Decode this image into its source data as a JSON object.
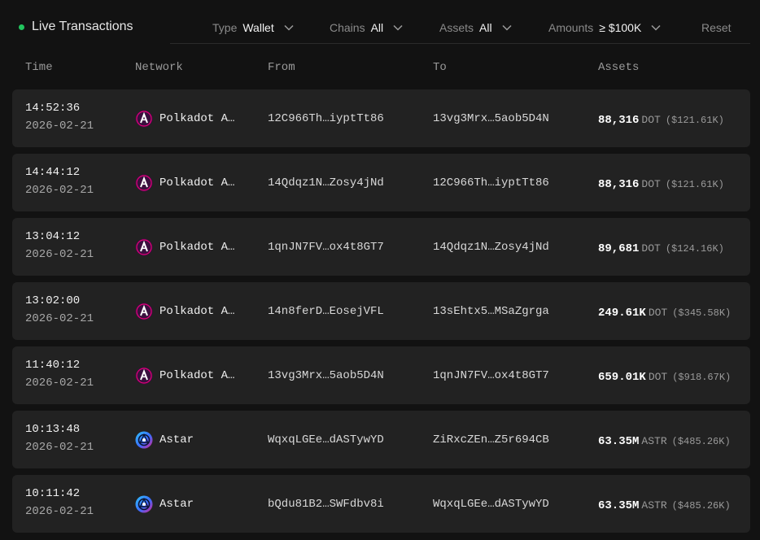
{
  "header": {
    "title": "Live Transactions",
    "live_color": "#22c55e",
    "filters": [
      {
        "label": "Type",
        "value": "Wallet"
      },
      {
        "label": "Chains",
        "value": "All"
      },
      {
        "label": "Assets",
        "value": "All"
      },
      {
        "label": "Amounts",
        "value": "≥ $100K"
      }
    ],
    "reset_label": "Reset"
  },
  "table": {
    "columns": [
      "Time",
      "Network",
      "From",
      "To",
      "Assets"
    ],
    "rows": [
      {
        "time": "14:52:36",
        "date": "2026-02-21",
        "network": "Polkadot A…",
        "network_icon": "polkadot-asset-hub-icon",
        "from": "12C966Th…iyptTt86",
        "to": "13vg3Mrx…5aob5D4N",
        "amount": "88,316",
        "symbol": "DOT",
        "usd": "($121.61K)"
      },
      {
        "time": "14:44:12",
        "date": "2026-02-21",
        "network": "Polkadot A…",
        "network_icon": "polkadot-asset-hub-icon",
        "from": "14Qdqz1N…Zosy4jNd",
        "to": "12C966Th…iyptTt86",
        "amount": "88,316",
        "symbol": "DOT",
        "usd": "($121.61K)"
      },
      {
        "time": "13:04:12",
        "date": "2026-02-21",
        "network": "Polkadot A…",
        "network_icon": "polkadot-asset-hub-icon",
        "from": "1qnJN7FV…ox4t8GT7",
        "to": "14Qdqz1N…Zosy4jNd",
        "amount": "89,681",
        "symbol": "DOT",
        "usd": "($124.16K)"
      },
      {
        "time": "13:02:00",
        "date": "2026-02-21",
        "network": "Polkadot A…",
        "network_icon": "polkadot-asset-hub-icon",
        "from": "14n8ferD…EosejVFL",
        "to": "13sEhtx5…MSaZgrga",
        "amount": "249.61K",
        "symbol": "DOT",
        "usd": "($345.58K)"
      },
      {
        "time": "11:40:12",
        "date": "2026-02-21",
        "network": "Polkadot A…",
        "network_icon": "polkadot-asset-hub-icon",
        "from": "13vg3Mrx…5aob5D4N",
        "to": "1qnJN7FV…ox4t8GT7",
        "amount": "659.01K",
        "symbol": "DOT",
        "usd": "($918.67K)"
      },
      {
        "time": "10:13:48",
        "date": "2026-02-21",
        "network": "Astar",
        "network_icon": "astar-icon",
        "from": "WqxqLGEe…dASTywYD",
        "to": "ZiRxcZEn…Z5r694CB",
        "amount": "63.35M",
        "symbol": "ASTR",
        "usd": "($485.26K)"
      },
      {
        "time": "10:11:42",
        "date": "2026-02-21",
        "network": "Astar",
        "network_icon": "astar-icon",
        "from": "bQdu81B2…SWFdbv8i",
        "to": "WqxqLGEe…dASTywYD",
        "amount": "63.35M",
        "symbol": "ASTR",
        "usd": "($485.26K)"
      }
    ]
  }
}
